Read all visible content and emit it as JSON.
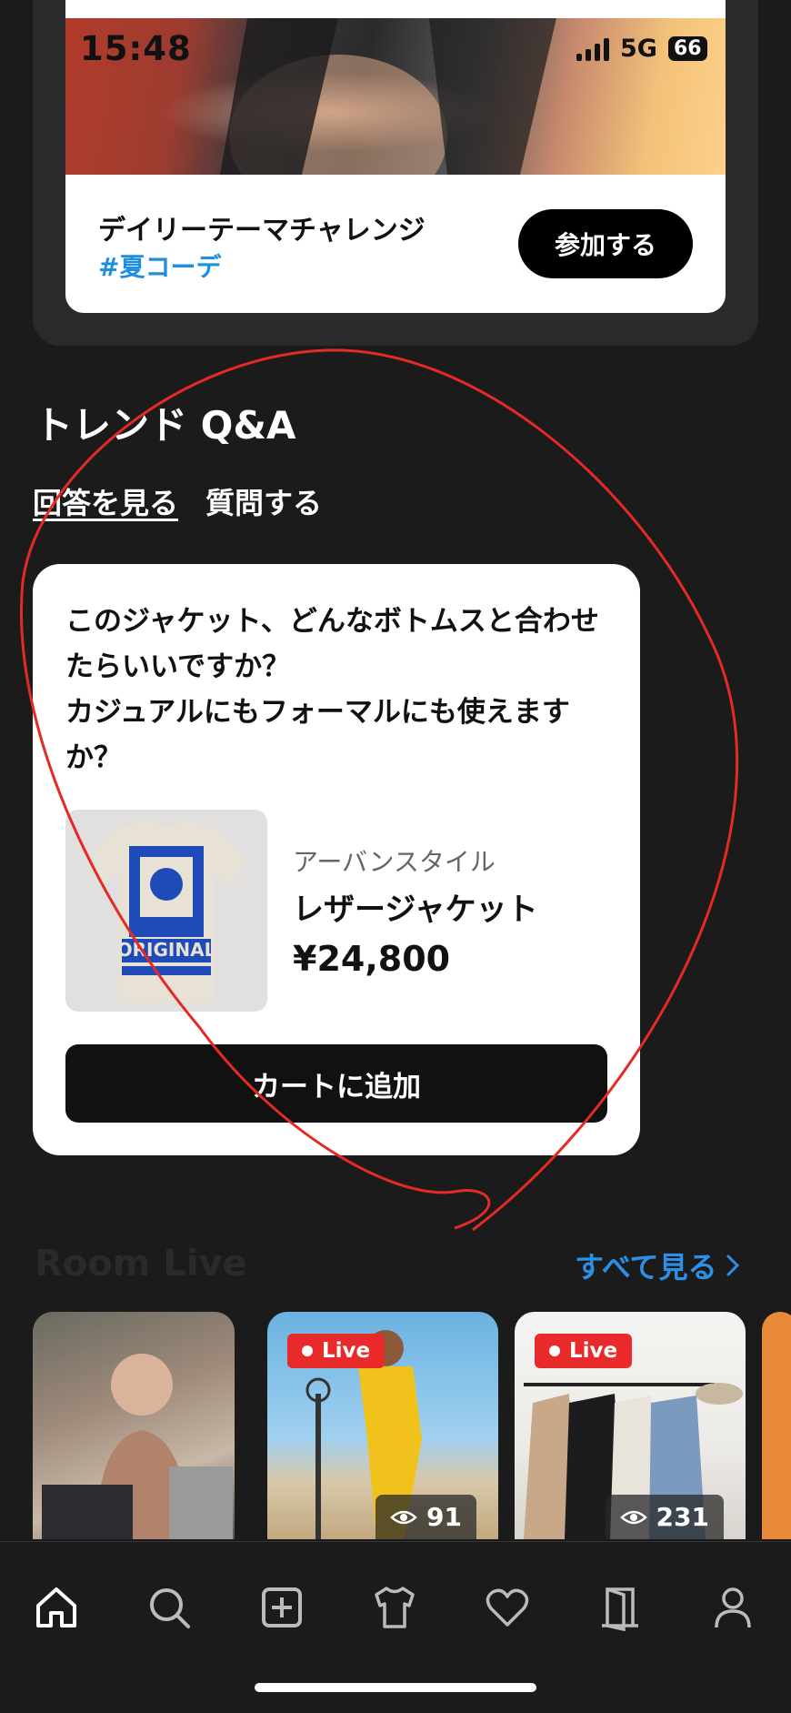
{
  "status_bar": {
    "time": "15:48",
    "network": "5G",
    "battery": "66"
  },
  "challenge": {
    "title": "デイリーテーマチャレンジ",
    "tag": "#夏コーデ",
    "join_label": "参加する"
  },
  "trend_qa": {
    "title": "トレンド Q&A",
    "tabs": [
      {
        "label": "回答を見る",
        "active": true
      },
      {
        "label": "質問する",
        "active": false
      }
    ],
    "question": "このジャケット、どんなボトムスと合わせたらいいですか？\nカジュアルにもフォーマルにも使えますか？",
    "product": {
      "brand": "アーバンスタイル",
      "name": "レザージャケット",
      "price": "¥24,800",
      "print_text": "ORIGINAL"
    },
    "cart_label": "カートに追加"
  },
  "room_live": {
    "title": "Room Live",
    "see_all": "すべて見る",
    "items": [
      {
        "live": false
      },
      {
        "live": true,
        "badge": "Live",
        "viewers": "91"
      },
      {
        "live": true,
        "badge": "Live",
        "viewers": "231"
      }
    ]
  },
  "bottom_nav": [
    "home-icon",
    "search-icon",
    "add-icon",
    "tshirt-icon",
    "heart-icon",
    "door-icon",
    "profile-icon"
  ],
  "colors": {
    "accent": "#1e8fe0",
    "live": "#e82a2a",
    "background": "#1b1b1c"
  }
}
